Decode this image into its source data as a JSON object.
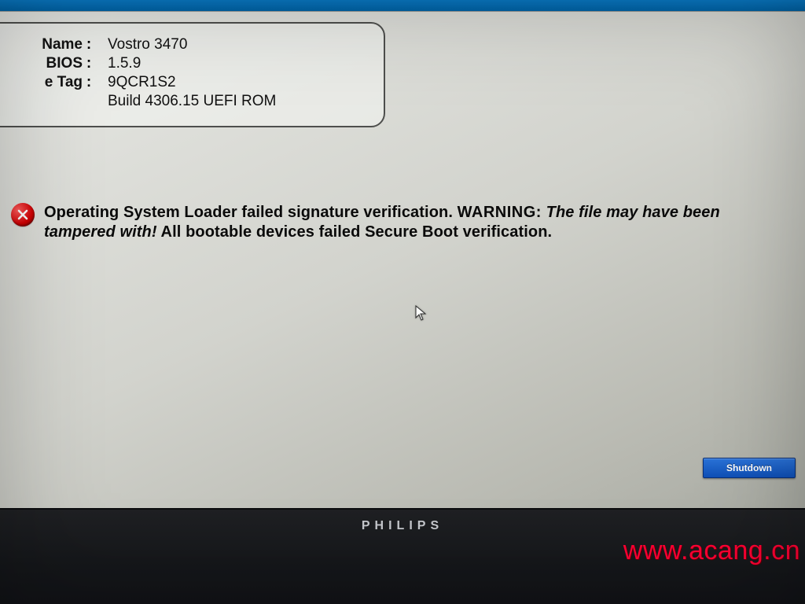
{
  "sysinfo": {
    "rows": [
      {
        "label": "Name",
        "value": "Vostro 3470"
      },
      {
        "label": "BIOS",
        "value": "1.5.9"
      },
      {
        "label": "e Tag",
        "value": "9QCR1S2"
      },
      {
        "label": "",
        "value": "Build  4306.15 UEFI ROM"
      }
    ]
  },
  "error": {
    "icon": "error-circle-x-icon",
    "prefix": "Operating System Loader failed signature verification. ",
    "warning_word": "WARNING:",
    "italic_tail": " The file may have been tampered with!",
    "suffix": " All bootable devices failed Secure Boot verification."
  },
  "buttons": {
    "shutdown": "Shutdown"
  },
  "bezel": {
    "brand": "PHILIPS"
  },
  "watermark": "www.acang.cn"
}
